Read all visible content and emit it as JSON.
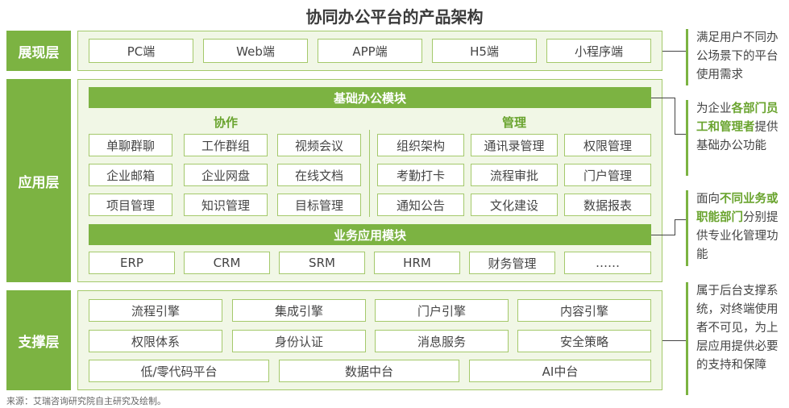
{
  "title": "协同办公平台的产品架构",
  "layers": {
    "presentation": "展现层",
    "application": "应用层",
    "support": "支撑层"
  },
  "presentation_items": [
    "PC端",
    "Web端",
    "APP端",
    "H5端",
    "小程序端"
  ],
  "basic_module": {
    "title": "基础办公模块",
    "collab_title": "协作",
    "manage_title": "管理",
    "collab": [
      "单聊群聊",
      "工作群组",
      "视频会议",
      "企业邮箱",
      "企业网盘",
      "在线文档",
      "项目管理",
      "知识管理",
      "目标管理"
    ],
    "manage": [
      "组织架构",
      "通讯录管理",
      "权限管理",
      "考勤打卡",
      "流程审批",
      "门户管理",
      "通知公告",
      "文化建设",
      "数据报表"
    ]
  },
  "business_module": {
    "title": "业务应用模块",
    "items": [
      "ERP",
      "CRM",
      "SRM",
      "HRM",
      "财务管理",
      "……"
    ]
  },
  "support_items": {
    "row1": [
      "流程引擎",
      "集成引擎",
      "门户引擎",
      "内容引擎"
    ],
    "row2": [
      "权限体系",
      "身份认证",
      "消息服务",
      "安全策略"
    ],
    "row3": [
      "低/零代码平台",
      "数据中台",
      "AI中台"
    ]
  },
  "notes": {
    "n1": "满足用户不同办公场景下的平台使用需求",
    "n2_a": "为企业",
    "n2_hl": "各部门员工和管理者",
    "n2_b": "提供基础办公功能",
    "n3_a": "面向",
    "n3_hl": "不同业务或职能部门",
    "n3_b": "分别提供专业化管理功能",
    "n4": "属于后台支撑系统，对终端使用者不可见，为上层应用提供必要的支持和保障"
  },
  "source": "来源：艾瑞咨询研究院自主研究及绘制。",
  "colors": {
    "accent": "#7cb342",
    "panel": "#f1f7e6",
    "border": "#a4c96b",
    "highlight": "#6aa42f"
  }
}
